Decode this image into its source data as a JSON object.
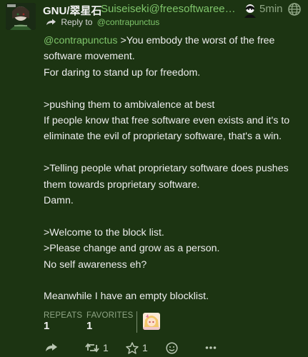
{
  "post": {
    "display_name": "GNU/翠星石",
    "handle": "Suiseiseki@freesoftwareextremist.com",
    "time": "5min",
    "reply_label": "Reply to",
    "reply_mention": "@contrapunctus"
  },
  "content": {
    "line1_mention": "@contrapunctus",
    "line1_rest": " >You embody the worst of the free software movement.",
    "line2": "For daring to stand up for freedom.",
    "line3": ">pushing them to ambivalence at best",
    "line4": "If people know that free software even exists and it's to eliminate the evil of proprietary software, that's a win.",
    "line5": ">Telling people what proprietary software does pushes them towards proprietary software.",
    "line6": "Damn.",
    "line7": ">Welcome to the block list.",
    "line8": ">Please change and grow as a person.",
    "line9": "No self awareness eh?",
    "line10": "Meanwhile I have an empty blocklist."
  },
  "stats": {
    "repeats_label": "REPEATS",
    "repeats_value": "1",
    "favorites_label": "FAVORITES",
    "favorites_value": "1"
  },
  "actions": {
    "repeat_count": "1",
    "favorite_count": "1"
  },
  "icons": {
    "reply": "reply-icon",
    "repeat": "repeat-icon",
    "favorite": "star-icon",
    "emoji": "emoji-icon",
    "more": "more-icon",
    "visibility": "globe-icon"
  },
  "colors": {
    "background": "#1c3412",
    "link": "#7fc56b",
    "muted": "#8fa585",
    "text": "#ececec"
  }
}
